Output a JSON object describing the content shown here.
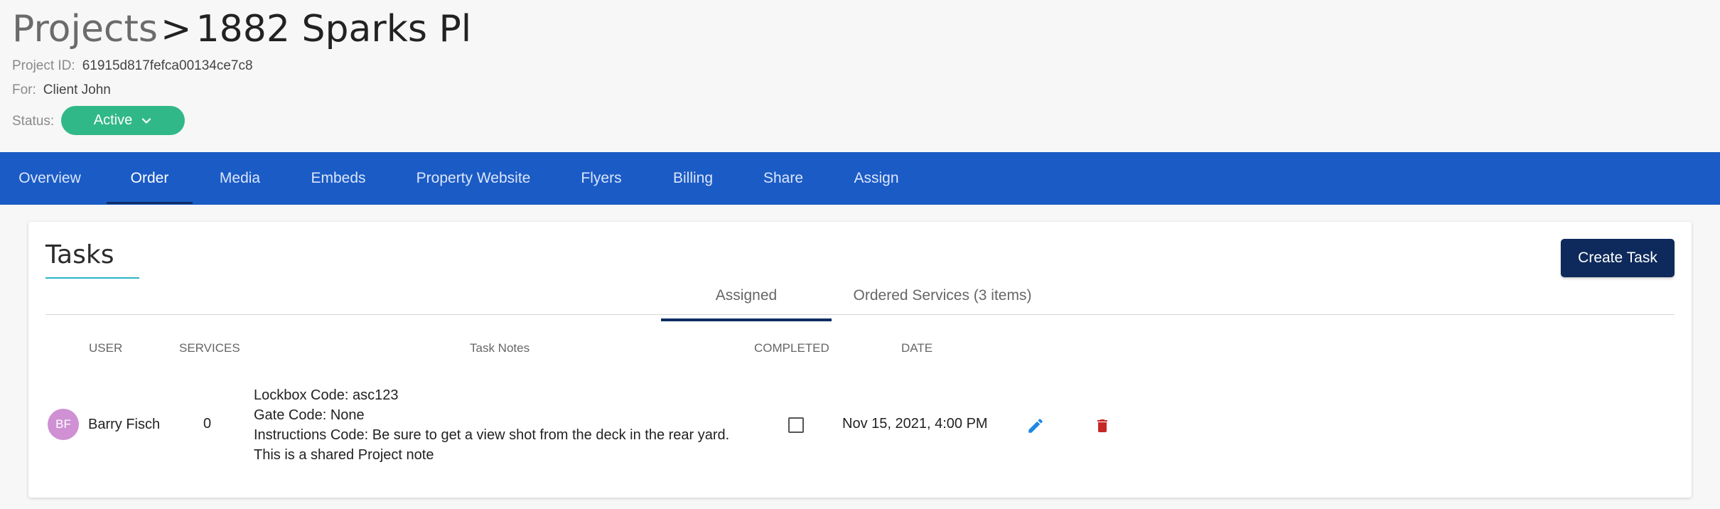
{
  "header": {
    "breadcrumb_root": "Projects",
    "breadcrumb_sep": ">",
    "project_name": "1882 Sparks Pl",
    "project_id_label": "Project ID:",
    "project_id": "61915d817fefca00134ce7c8",
    "for_label": "For:",
    "for_value": "Client John",
    "status_label": "Status:",
    "status_value": "Active"
  },
  "nav": {
    "tabs": [
      "Overview",
      "Order",
      "Media",
      "Embeds",
      "Property Website",
      "Flyers",
      "Billing",
      "Share",
      "Assign"
    ],
    "active": "Order"
  },
  "tasks": {
    "title": "Tasks",
    "create_label": "Create Task",
    "subtabs": [
      "Assigned",
      "Ordered Services (3 items)"
    ],
    "active_subtab": "Assigned",
    "columns": [
      "USER",
      "SERVICES",
      "Task Notes",
      "COMPLETED",
      "DATE"
    ],
    "rows": [
      {
        "initials": "BF",
        "user": "Barry Fisch",
        "services": "0",
        "notes": [
          "Lockbox Code: asc123",
          "Gate Code: None",
          "Instructions Code: Be sure to get a view shot from the deck in the rear yard.",
          "This is a shared Project note"
        ],
        "completed": false,
        "date": "Nov 15, 2021, 4:00 PM"
      }
    ]
  },
  "colors": {
    "nav_bg": "#1b5bc5",
    "status_green": "#30b889",
    "create_btn": "#0e2a5c",
    "edit_icon": "#1e88e5",
    "delete_icon": "#c62828",
    "avatar": "#cf91d3"
  },
  "icons": {
    "status_dropdown": "chevron-down-icon",
    "edit": "pencil-icon",
    "delete": "trash-icon"
  }
}
